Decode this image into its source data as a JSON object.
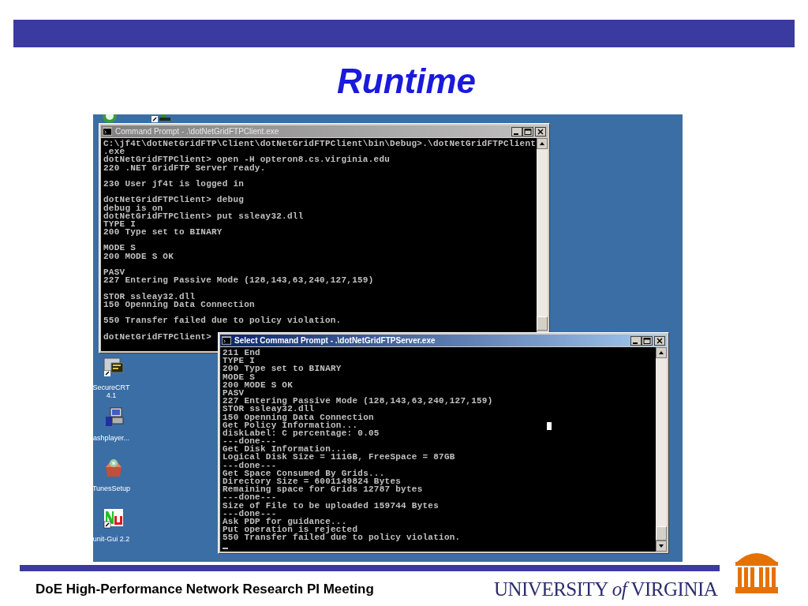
{
  "slide": {
    "title": "Runtime"
  },
  "desktop": {
    "icons": [
      {
        "label": "SecureCRT\n4.1",
        "kind": "terminal"
      },
      {
        "label": "ashplayer...",
        "kind": "installer"
      },
      {
        "label": "TunesSetup",
        "kind": "box"
      },
      {
        "label": "unit-Gui 2.2",
        "kind": "nu"
      }
    ],
    "windows": [
      {
        "title": "Command Prompt - .\\dotNetGridFTPClient.exe",
        "active": false,
        "blocks": [
          [
            "C:\\jf4t\\dotNetGridFTP\\Client\\dotNetGridFTPClient\\bin\\Debug>.\\dotNetGridFTPClient",
            ".exe",
            "dotNetGridFTPClient> open -H opteron8.cs.virginia.edu",
            "220 .NET GridFTP Server ready."
          ],
          [
            "230 User jf4t is logged in"
          ],
          [
            "dotNetGridFTPClient> debug",
            "debug is on",
            "dotNetGridFTPClient> put ssleay32.dll",
            "TYPE I",
            "200 Type set to BINARY"
          ],
          [
            "MODE S",
            "200 MODE S OK"
          ],
          [
            "PASV",
            "227 Entering Passive Mode (128,143,63,240,127,159)"
          ],
          [
            "STOR ssleay32.dll",
            "150 Openning Data Connection"
          ],
          [
            "550 Transfer failed due to policy violation."
          ],
          [
            "dotNetGridFTPClient>"
          ]
        ]
      },
      {
        "title": "Select Command Prompt - .\\dotNetGridFTPServer.exe",
        "active": true,
        "blocks": [
          [
            "211 End",
            "TYPE I",
            "200 Type set to BINARY",
            "MODE S",
            "200 MODE S OK",
            "PASV",
            "227 Entering Passive Mode (128,143,63,240,127,159)",
            "STOR ssleay32.dll",
            "150 Openning Data Connection",
            "Get Policy Information...",
            "diskLabel: C percentage: 0.05",
            "---done---",
            "Get Disk Information...",
            "Logical Disk Size = 111GB, FreeSpace = 87GB",
            "---done---",
            "Get Space Consumed By Grids...",
            "Directory Size = 6001149824 Bytes",
            "Remaining space for Grids 12787 bytes",
            "---done---",
            "Size of File to be uploaded 159744 Bytes",
            "---done---",
            "Ask PDP for guidance...",
            "Put operation is rejected",
            "550 Transfer failed due to policy violation."
          ]
        ]
      }
    ]
  },
  "footer": {
    "text": "DoE High-Performance Network Research PI Meeting",
    "logo": "UNIVERSITY *of* VIRGINIA"
  }
}
